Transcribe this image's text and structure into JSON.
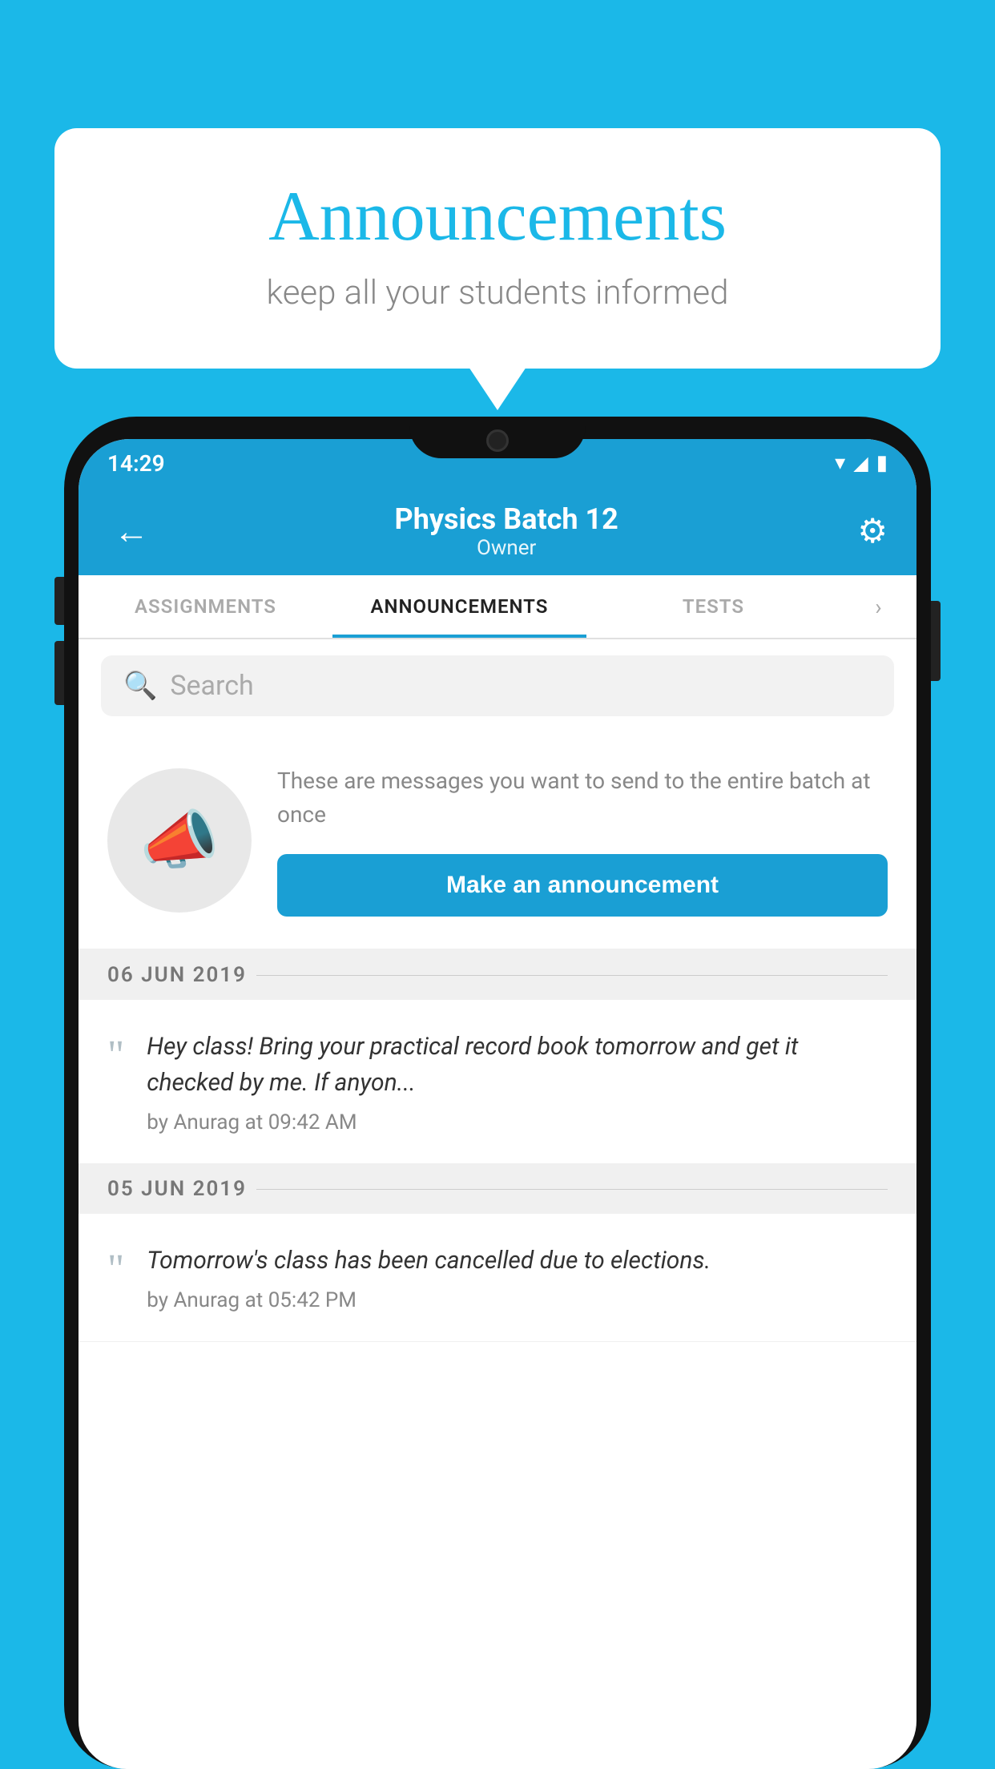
{
  "background_color": "#1bb8e8",
  "speech_bubble": {
    "title": "Announcements",
    "subtitle": "keep all your students informed"
  },
  "phone": {
    "status_bar": {
      "time": "14:29",
      "wifi": "▾",
      "signal": "▲",
      "battery": "▮"
    },
    "header": {
      "batch_name": "Physics Batch 12",
      "role": "Owner",
      "back_label": "←",
      "settings_label": "⚙"
    },
    "tabs": [
      {
        "label": "ASSIGNMENTS",
        "active": false
      },
      {
        "label": "ANNOUNCEMENTS",
        "active": true
      },
      {
        "label": "TESTS",
        "active": false
      }
    ],
    "search": {
      "placeholder": "Search"
    },
    "promo": {
      "description": "These are messages you want to send to the entire batch at once",
      "button_label": "Make an announcement"
    },
    "announcements": [
      {
        "date": "06  JUN  2019",
        "text": "Hey class! Bring your practical record book tomorrow and get it checked by me. If anyon...",
        "author": "by Anurag at 09:42 AM"
      },
      {
        "date": "05  JUN  2019",
        "text": "Tomorrow's class has been cancelled due to elections.",
        "author": "by Anurag at 05:42 PM"
      }
    ]
  }
}
